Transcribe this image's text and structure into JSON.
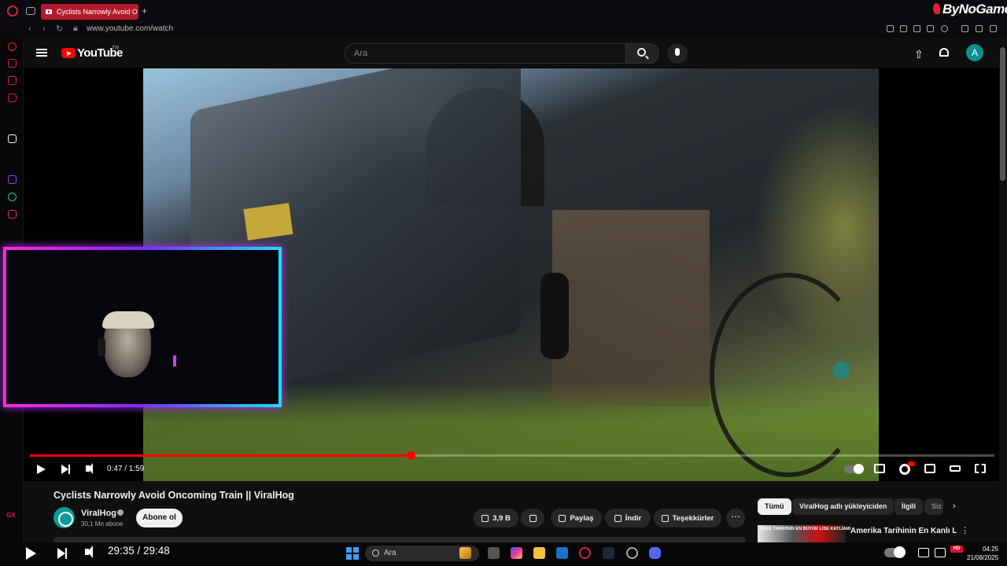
{
  "browser": {
    "tab_title": "Cyclists Narrowly Avoid O",
    "new_tab_symbol": "+",
    "url": "www.youtube.com/watch",
    "watermark": "ByNoGame"
  },
  "youtube": {
    "logo_text": "YouTube",
    "country_code": "TR",
    "search_placeholder": "Ara",
    "avatar_letter": "A"
  },
  "player": {
    "progress_fraction": 0.395,
    "current_time": "0:47 / 1:59"
  },
  "video_info": {
    "title": "Cyclists Narrowly Avoid Oncoming Train || ViralHog",
    "channel_name": "ViralHog",
    "subscribers": "30,1 Mn abone",
    "subscribe_label": "Abone ol",
    "likes": "3,9 B",
    "share_label": "Paylaş",
    "download_label": "İndir",
    "thanks_label": "Teşekkürler",
    "more_symbol": "⋯"
  },
  "related": {
    "chips": [
      "Tümü",
      "ViralHog adlı yükleyiciden",
      "İlgili",
      "Siz"
    ],
    "first_video_thumb_text": "ÜLKE TARİHİNİN EN BÜYÜK LİSE KATLİAMI",
    "first_video_title": "Amerika Tarihinin En Kanlı Lise Saldırısı",
    "more_symbol": "⋮"
  },
  "taskbar": {
    "stream_time": "29:35 / 29:48",
    "search_placeholder": "Ara",
    "clock_time": "04:25",
    "clock_date": "21/08/2025",
    "hd_badge": "HD"
  },
  "colors": {
    "youtube_red": "#ff0000",
    "opera_red": "#d7233b",
    "channel_teal": "#0d9b9b"
  }
}
